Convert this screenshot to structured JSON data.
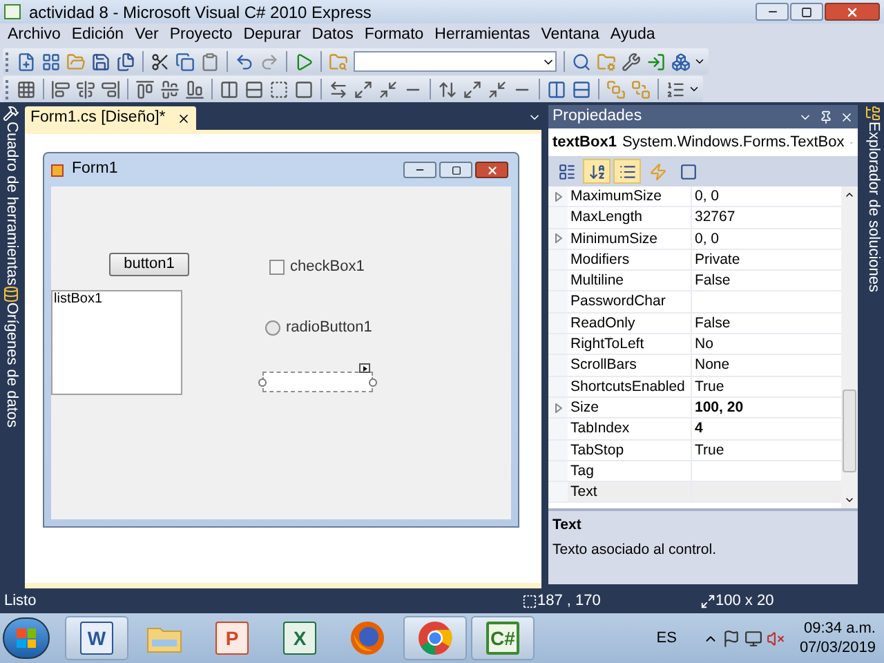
{
  "window": {
    "title": "actividad 8 - Microsoft Visual C# 2010 Express"
  },
  "menu": [
    "Archivo",
    "Edición",
    "Ver",
    "Proyecto",
    "Depurar",
    "Datos",
    "Formato",
    "Herramientas",
    "Ventana",
    "Ayuda"
  ],
  "left_dock": [
    {
      "label": "Cuadro de herramientas"
    },
    {
      "label": "Orígenes de datos"
    }
  ],
  "right_dock": [
    {
      "label": "Explorador de soluciones"
    }
  ],
  "document_tab": {
    "label": "Form1.cs [Diseño]*",
    "selected": true
  },
  "form": {
    "title": "Form1",
    "controls": [
      {
        "kind": "button",
        "text": "button1"
      },
      {
        "kind": "checkbox",
        "text": "checkBox1",
        "checked": false
      },
      {
        "kind": "listbox",
        "items": [
          "listBox1"
        ]
      },
      {
        "kind": "radio",
        "text": "radioButton1",
        "selected": false
      },
      {
        "kind": "textbox",
        "selected": true
      }
    ]
  },
  "properties": {
    "title": "Propiedades",
    "object_name": "textBox1",
    "object_type": "System.Windows.Forms.TextBox",
    "view_buttons": [
      {
        "kind": "categorized",
        "selected": false
      },
      {
        "kind": "alphabetical",
        "selected": true
      },
      {
        "kind": "properties",
        "selected": true
      },
      {
        "kind": "events",
        "selected": false
      },
      {
        "kind": "pages",
        "selected": false
      }
    ],
    "rows": [
      {
        "name": "MaximumSize",
        "value": "0, 0",
        "expandable": true,
        "modified": false,
        "selected": false
      },
      {
        "name": "MaxLength",
        "value": "32767",
        "expandable": false,
        "modified": false,
        "selected": false
      },
      {
        "name": "MinimumSize",
        "value": "0, 0",
        "expandable": true,
        "modified": false,
        "selected": false
      },
      {
        "name": "Modifiers",
        "value": "Private",
        "expandable": false,
        "modified": false,
        "selected": false
      },
      {
        "name": "Multiline",
        "value": "False",
        "expandable": false,
        "modified": false,
        "selected": false
      },
      {
        "name": "PasswordChar",
        "expandable": false,
        "selected": false
      },
      {
        "name": "ReadOnly",
        "value": "False",
        "expandable": false,
        "modified": false,
        "selected": false
      },
      {
        "name": "RightToLeft",
        "value": "No",
        "expandable": false,
        "modified": false,
        "selected": false
      },
      {
        "name": "ScrollBars",
        "value": "None",
        "expandable": false,
        "modified": false,
        "selected": false
      },
      {
        "name": "ShortcutsEnabled",
        "value": "True",
        "expandable": false,
        "modified": false,
        "selected": false
      },
      {
        "name": "Size",
        "value": "100, 20",
        "expandable": true,
        "modified": true,
        "selected": false
      },
      {
        "name": "TabIndex",
        "value": "4",
        "expandable": false,
        "modified": true,
        "selected": false
      },
      {
        "name": "TabStop",
        "value": "True",
        "expandable": false,
        "modified": false,
        "selected": false
      },
      {
        "name": "Tag",
        "expandable": false,
        "selected": false
      },
      {
        "name": "Text",
        "expandable": false,
        "selected": true
      }
    ],
    "description_title": "Text",
    "description": "Texto asociado al control."
  },
  "status_bar": {
    "text": "Listo",
    "position": "187 , 170",
    "size": "100 x 20"
  },
  "taskbar": {
    "apps": [
      {
        "kind": "word",
        "glyph": "W",
        "running": true
      },
      {
        "kind": "folder",
        "running": false
      },
      {
        "kind": "powerpoint",
        "glyph": "P",
        "running": false
      },
      {
        "kind": "excel",
        "glyph": "X",
        "running": false
      },
      {
        "kind": "firefox",
        "running": false
      },
      {
        "kind": "chrome",
        "running": true
      },
      {
        "kind": "csharp",
        "glyph": "C#",
        "running": true
      }
    ],
    "language": "ES",
    "time": "09:34 a.m.",
    "date": "07/03/2019"
  }
}
